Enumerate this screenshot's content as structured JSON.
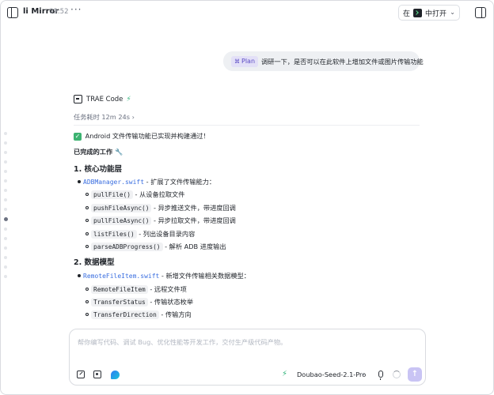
{
  "titlebar": {
    "app_name": "li Mirror",
    "time": "09:52",
    "more": "···",
    "open_in_prefix": "在",
    "open_in_suffix": "中打开",
    "open_chevron": "⌄"
  },
  "conversation": {
    "user_message": {
      "mode_chip": "Plan",
      "text": "调研一下，是否可以在此软件上增加文件或图片传输功能"
    },
    "agent": {
      "name": "TRAE Code",
      "task_duration": "任务耗时 12m 24s",
      "task_chevron": "›"
    },
    "result": {
      "status_line": "Android 文件传输功能已实现并构建通过！",
      "completed_heading": "已完成的工作",
      "completed_emoji": "🔧",
      "sections": [
        {
          "heading": "1. 核心功能层",
          "file": "ADBManager.swift",
          "file_desc": " - 扩展了文件传输能力：",
          "items": [
            {
              "code": "pullFile()",
              "desc": " - 从设备拉取文件"
            },
            {
              "code": "pushFileAsync()",
              "desc": " - 异步推送文件，带进度回调"
            },
            {
              "code": "pullFileAsync()",
              "desc": " - 异步拉取文件，带进度回调"
            },
            {
              "code": "listFiles()",
              "desc": " - 列出设备目录内容"
            },
            {
              "code": "parseADBProgress()",
              "desc": " - 解析 ADB 进度输出"
            }
          ]
        },
        {
          "heading": "2. 数据模型",
          "file": "RemoteFileItem.swift",
          "file_desc": " - 新增文件传输相关数据模型：",
          "items": [
            {
              "code": "RemoteFileItem",
              "desc": " - 远程文件项"
            },
            {
              "code": "TransferStatus",
              "desc": " - 传输状态枚举"
            },
            {
              "code": "TransferDirection",
              "desc": " - 传输方向"
            }
          ]
        }
      ]
    }
  },
  "composer": {
    "placeholder": "帮你编写代码、调试 Bug、优化性能等开发工作，交付生产级代码产物。",
    "model": "Doubao-Seed-2.1-Pro",
    "model_chevron": "⌄",
    "send_glyph": "↑"
  },
  "colors": {
    "accent": "#3b6fe0",
    "plan_chip": "#5b4bc4",
    "send_button": "#c9c4f4",
    "success": "#3cb371"
  }
}
